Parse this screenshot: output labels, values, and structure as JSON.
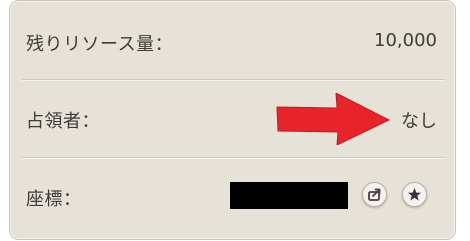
{
  "rows": {
    "resources": {
      "label": "残りリソース量：",
      "value": "10,000"
    },
    "occupant": {
      "label": "占領者：",
      "value": "なし"
    },
    "coordinates": {
      "label": "座標："
    }
  },
  "annotation": {
    "color": "#e8232a"
  },
  "icons": {
    "share": "share-icon",
    "favorite": "star-icon"
  }
}
